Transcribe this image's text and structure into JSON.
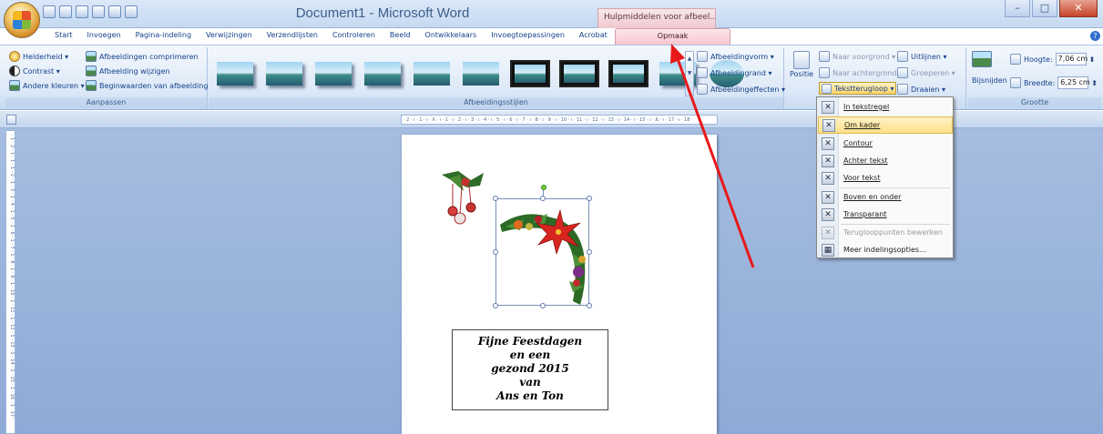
{
  "window": {
    "title": "Document1 - Microsoft Word",
    "context_group": "Hulpmiddelen voor afbeel...",
    "min": "–",
    "max": "□",
    "close": "✕"
  },
  "tabs": [
    "Start",
    "Invoegen",
    "Pagina-indeling",
    "Verwijzingen",
    "Verzendlijsten",
    "Controleren",
    "Beeld",
    "Ontwikkelaars",
    "Invoegtoepassingen",
    "Acrobat"
  ],
  "active_tab": "Opmaak",
  "help": "?",
  "aanpassen": {
    "label": "Aanpassen",
    "helderheid": "Helderheid ▾",
    "contrast": "Contrast ▾",
    "andere_kleuren": "Andere kleuren ▾",
    "comprimeren": "Afbeeldingen comprimeren",
    "wijzigen": "Afbeelding wijzigen",
    "beginwaarden": "Beginwaarden van afbeelding"
  },
  "stijlen": {
    "label": "Afbeeldingsstijlen",
    "vorm": "Afbeeldingvorm ▾",
    "rand": "Afbeeldingrand ▾",
    "effecten": "Afbeeldingeffecten ▾"
  },
  "schikken": {
    "positie": "Positie",
    "voorgrond": "Naar voorgrond ▾",
    "achtergrond": "Naar achtergrond ▾",
    "tekstterugloop": "Tekstterugloop ▾",
    "uitlijnen": "Uitlijnen ▾",
    "groeperen": "Groeperen ▾",
    "draaien": "Draaien ▾"
  },
  "grootte": {
    "label": "Grootte",
    "bijsnijden": "Bijsnijden",
    "hoogte_label": "Hoogte:",
    "hoogte": "7,06 cm",
    "breedte_label": "Breedte:",
    "breedte": "6,25 cm"
  },
  "ruler": "· 2 · ı · 1 · ı · X · ı · 1 · ı · 2 · ı · 3 · ı · 4 · ı · 5 · ı · 6 · ı · 7 · ı · 8 · ı · 9 · ı · 10 · ı · 11 · ı · 12 · ı · 13 · ı · 14 · ı · 15 · ı · Δ · ı · 17 · ı · 18 ·",
  "vruler": "· 1 · 2 · 1 · 1 · 1 · 2 · 1 · 3 · 1 · 4 · 1 · 5 · 1 · 6 · 1 · 7 · 1 · 8 · 1 · 9 · 1 · 10 · 1 · 11 · 1 · 12 · 1 · 13 · 1 · 14 · 1 · 15 · 1 · 16 · 1 · 17 ·",
  "menu": {
    "in_tekstregel": "In tekstregel",
    "om_kader": "Om kader",
    "contour": "Contour",
    "achter_tekst": "Achter tekst",
    "voor_tekst": "Voor tekst",
    "boven_onder": "Boven en onder",
    "transparant": "Transparant",
    "terugloop": "Teruglooppunten bewerken",
    "meer": "Meer indelingsopties..."
  },
  "card_lines": [
    "Fijne Feestdagen",
    "en een",
    "gezond 2015",
    "van",
    "Ans en Ton"
  ],
  "colors": {
    "arrow": "#e8181a",
    "highlight": "#fde08a",
    "context_tab": "#f7c6ce"
  }
}
